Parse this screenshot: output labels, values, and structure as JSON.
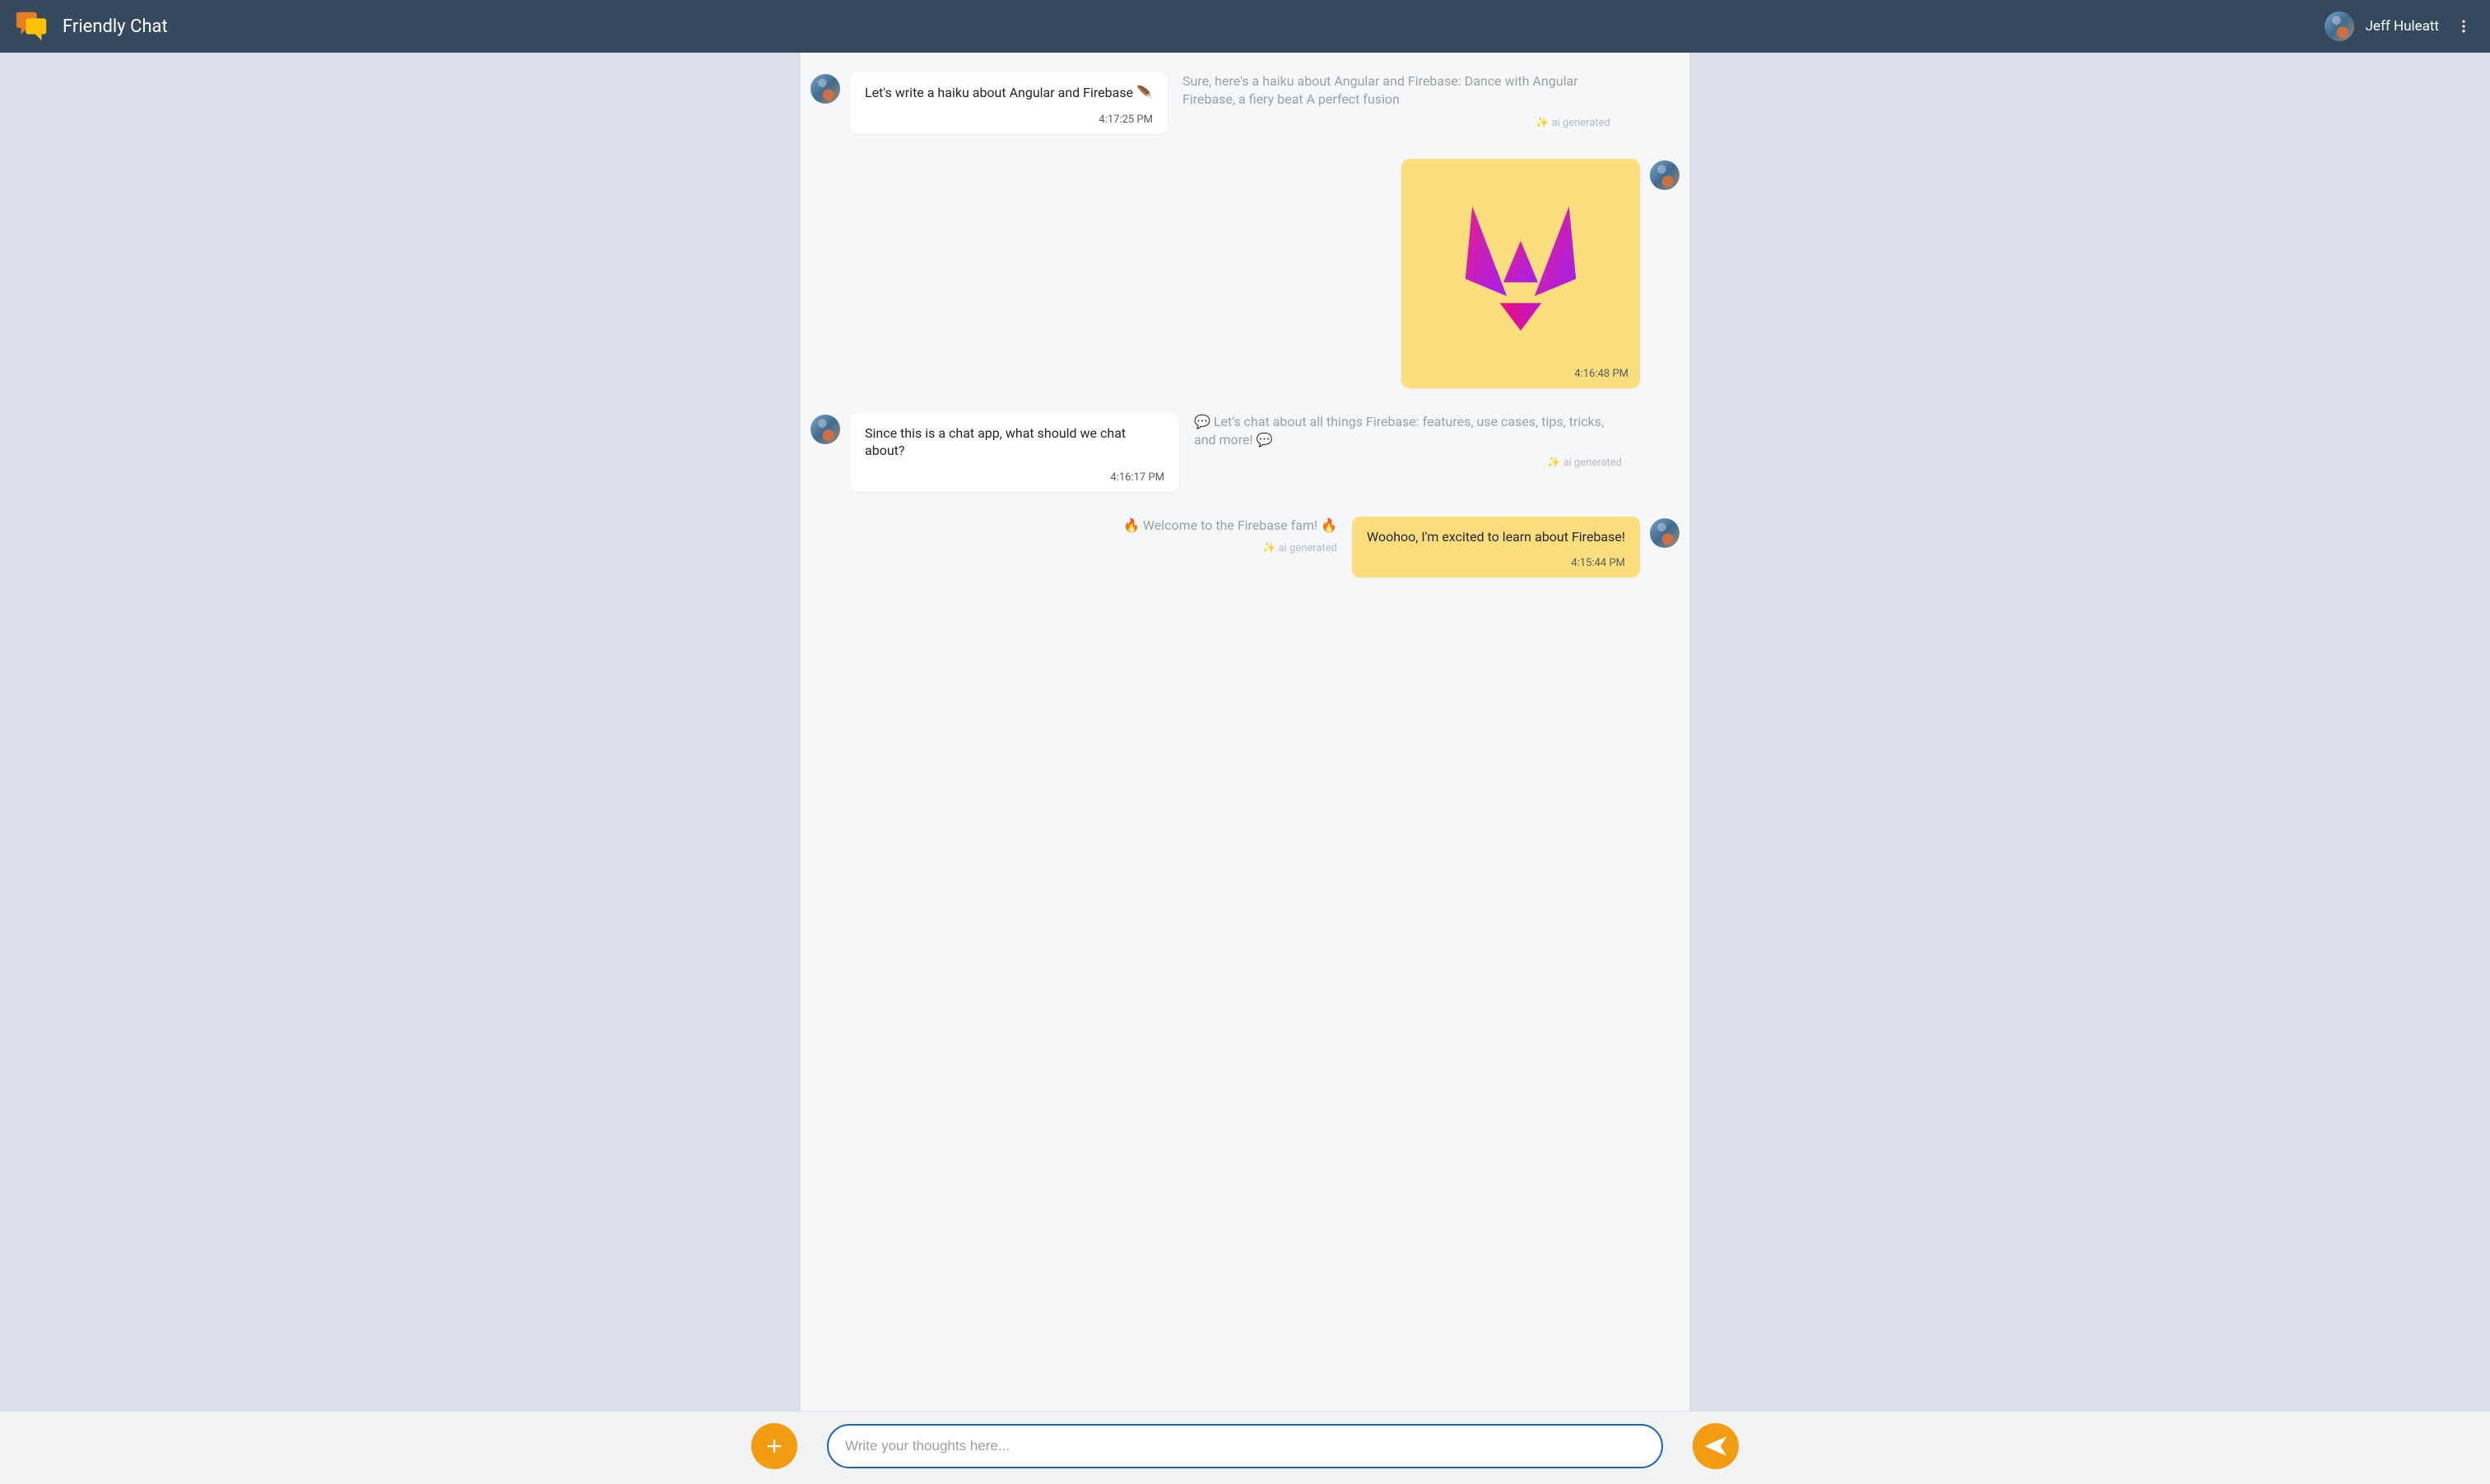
{
  "header": {
    "app_title": "Friendly Chat",
    "user_name": "Jeff Huleatt"
  },
  "ai_generated_label": "ai generated",
  "messages": [
    {
      "side": "left",
      "bubble_text": "Let's write a haiku about Angular and Firebase 🪶",
      "bubble_time": "4:17:25 PM",
      "ai_text": "Sure, here's a haiku about Angular and Firebase: Dance with Angular Firebase, a fiery beat A perfect fusion"
    },
    {
      "side": "right",
      "type": "image",
      "bubble_time": "4:16:48 PM"
    },
    {
      "side": "left",
      "bubble_text": "Since this is a chat app, what should we chat about?",
      "bubble_time": "4:16:17 PM",
      "ai_text": "💬 Let's chat about all things Firebase: features, use cases, tips, tricks, and more! 💬"
    },
    {
      "side": "right",
      "bubble_text": "Woohoo, I'm excited to learn about Firebase!",
      "bubble_time": "4:15:44 PM",
      "ai_text": "🔥 Welcome to the Firebase fam! 🔥"
    }
  ],
  "composer": {
    "placeholder": "Write your thoughts here..."
  }
}
